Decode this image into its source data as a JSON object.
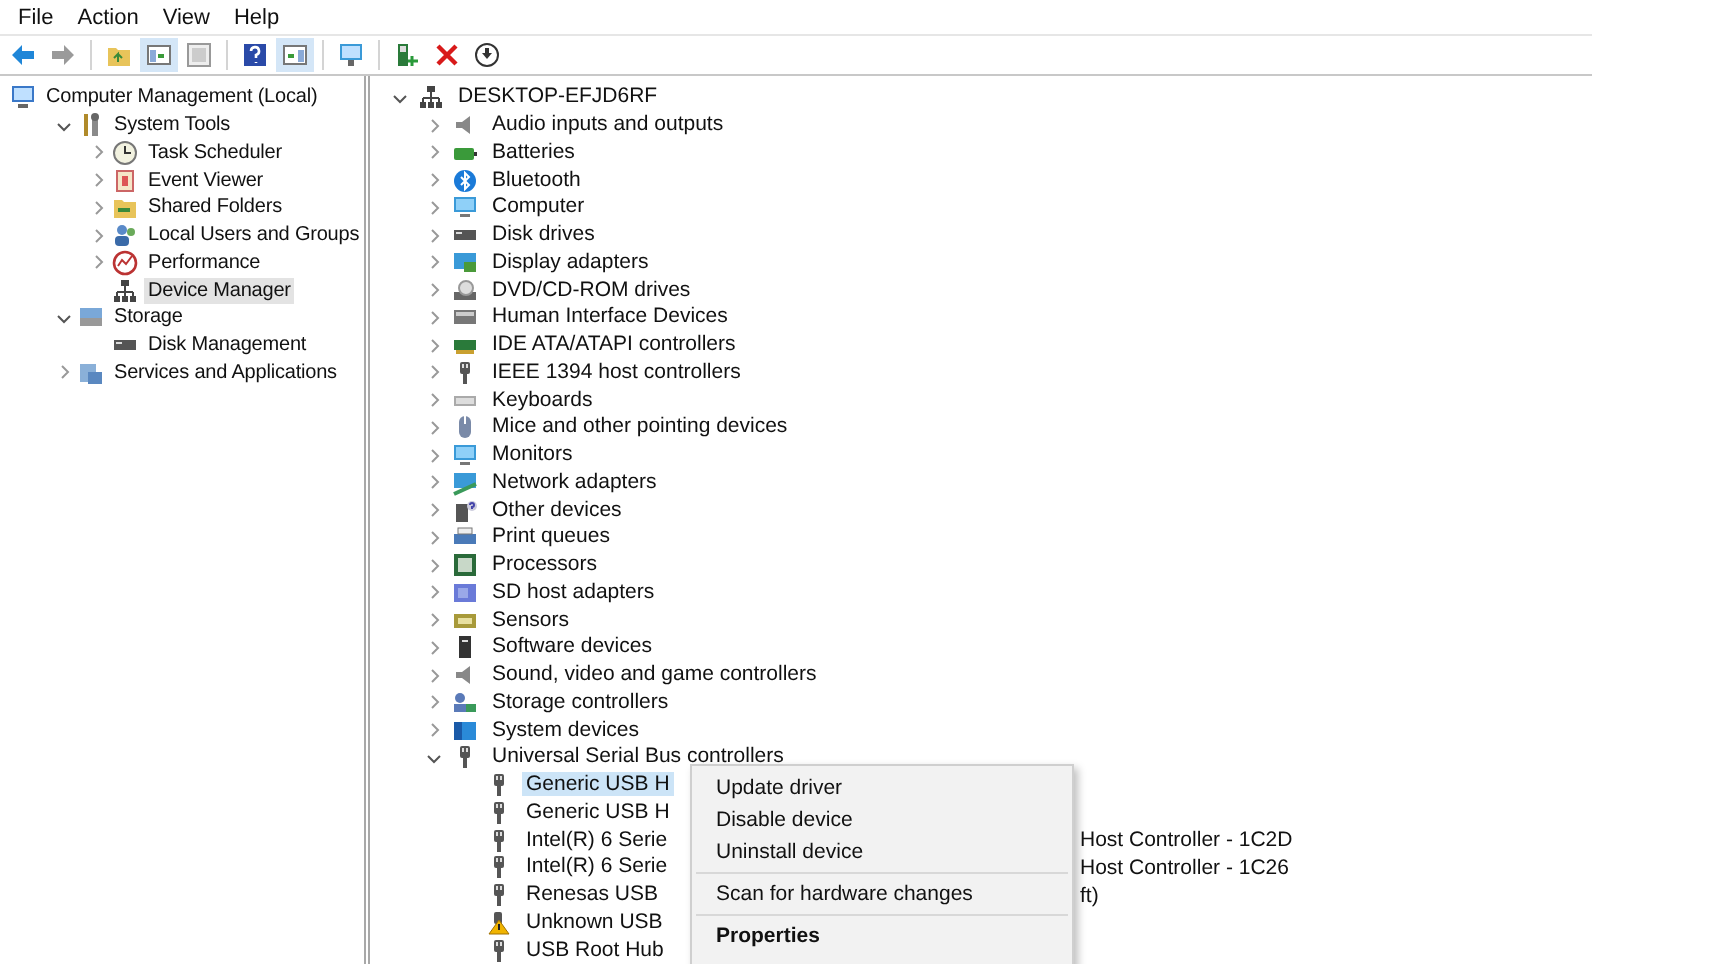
{
  "menu_bar": [
    "File",
    "Action",
    "View",
    "Help"
  ],
  "toolbar": [
    {
      "pressed": false
    },
    {
      "pressed": false
    },
    {
      "pressed": false
    },
    {
      "pressed": true
    },
    {
      "pressed": false
    },
    {
      "pressed": false
    },
    {
      "pressed": true
    },
    {
      "pressed": false
    },
    {
      "pressed": false
    },
    {
      "pressed": false
    },
    {
      "pressed": false
    }
  ],
  "console_tree": [
    {
      "label": "Computer Management (Local)",
      "selected": false,
      "children": [
        {
          "label": "System Tools",
          "expanded": true,
          "selected": false,
          "children": [
            {
              "label": "Task Scheduler",
              "expanded": false,
              "selected": false
            },
            {
              "label": "Event Viewer",
              "expanded": false,
              "selected": false
            },
            {
              "label": "Shared Folders",
              "expanded": false,
              "selected": false
            },
            {
              "label": "Local Users and Groups",
              "expanded": false,
              "selected": false
            },
            {
              "label": "Performance",
              "expanded": false,
              "selected": false
            },
            {
              "label": "Device Manager",
              "selected": true
            }
          ]
        },
        {
          "label": "Storage",
          "expanded": true,
          "selected": false,
          "children": [
            {
              "label": "Disk Management",
              "selected": false
            }
          ]
        },
        {
          "label": "Services and Applications",
          "expanded": false,
          "selected": false
        }
      ]
    }
  ],
  "device_tree": [
    {
      "label": "DESKTOP-EFJD6RF",
      "expanded": true,
      "selected": false,
      "children": [
        {
          "label": "Audio inputs and outputs",
          "expanded": false,
          "selected": false
        },
        {
          "label": "Batteries",
          "expanded": false,
          "selected": false
        },
        {
          "label": "Bluetooth",
          "expanded": false,
          "selected": false
        },
        {
          "label": "Computer",
          "expanded": false,
          "selected": false
        },
        {
          "label": "Disk drives",
          "expanded": false,
          "selected": false
        },
        {
          "label": "Display adapters",
          "expanded": false,
          "selected": false
        },
        {
          "label": "DVD/CD-ROM drives",
          "expanded": false,
          "selected": false
        },
        {
          "label": "Human Interface Devices",
          "expanded": false,
          "selected": false
        },
        {
          "label": "IDE ATA/ATAPI controllers",
          "expanded": false,
          "selected": false
        },
        {
          "label": "IEEE 1394 host controllers",
          "expanded": false,
          "selected": false
        },
        {
          "label": "Keyboards",
          "expanded": false,
          "selected": false
        },
        {
          "label": "Mice and other pointing devices",
          "expanded": false,
          "selected": false
        },
        {
          "label": "Monitors",
          "expanded": false,
          "selected": false
        },
        {
          "label": "Network adapters",
          "expanded": false,
          "selected": false
        },
        {
          "label": "Other devices",
          "expanded": false,
          "selected": false
        },
        {
          "label": "Print queues",
          "expanded": false,
          "selected": false
        },
        {
          "label": "Processors",
          "expanded": false,
          "selected": false
        },
        {
          "label": "SD host adapters",
          "expanded": false,
          "selected": false
        },
        {
          "label": "Sensors",
          "expanded": false,
          "selected": false
        },
        {
          "label": "Software devices",
          "expanded": false,
          "selected": false
        },
        {
          "label": "Sound, video and game controllers",
          "expanded": false,
          "selected": false
        },
        {
          "label": "Storage controllers",
          "expanded": false,
          "selected": false
        },
        {
          "label": "System devices",
          "expanded": false,
          "selected": false
        },
        {
          "label": "Universal Serial Bus controllers",
          "expanded": true,
          "selected": false,
          "children": [
            {
              "label": "Generic USB H",
              "selected": true,
              "warning": false
            },
            {
              "label": "Generic USB H",
              "selected": false,
              "warning": false
            },
            {
              "label": "Intel(R) 6 Serie",
              "tail": "Host Controller - 1C2D",
              "selected": false,
              "warning": false
            },
            {
              "label": "Intel(R) 6 Serie",
              "tail": "Host Controller - 1C26",
              "selected": false,
              "warning": false
            },
            {
              "label": "Renesas USB",
              "tail": "ft)",
              "selected": false,
              "warning": false
            },
            {
              "label": "Unknown USB",
              "selected": false,
              "warning": true
            },
            {
              "label": "USB Root Hub",
              "selected": false,
              "warning": false
            }
          ]
        }
      ]
    }
  ],
  "context_menu": [
    {
      "kind": "command",
      "label": "Update driver",
      "default": false
    },
    {
      "kind": "command",
      "label": "Disable device",
      "default": false
    },
    {
      "kind": "command",
      "label": "Uninstall device",
      "default": false
    },
    {
      "kind": "separator"
    },
    {
      "kind": "command",
      "label": "Scan for hardware changes",
      "default": false
    },
    {
      "kind": "separator"
    },
    {
      "kind": "command",
      "label": "Properties",
      "default": true
    }
  ]
}
